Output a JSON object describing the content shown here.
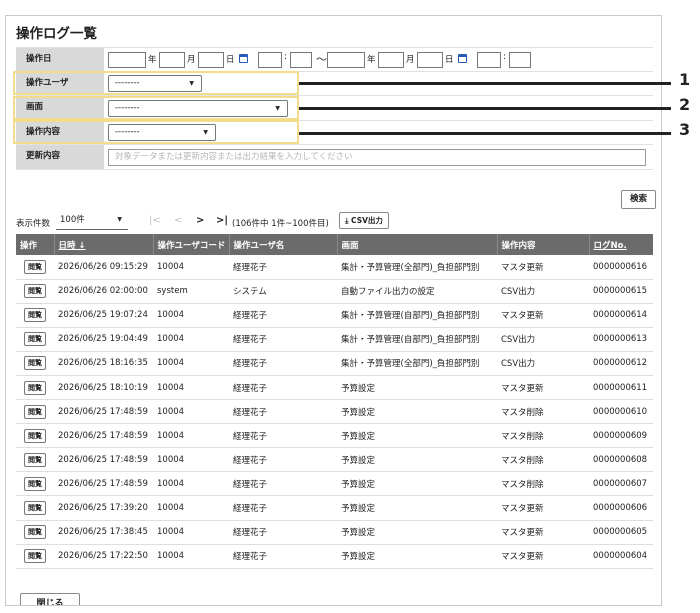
{
  "page": {
    "title": "操作ログ一覧"
  },
  "filters": {
    "date": {
      "label": "操作日",
      "year_unit": "年",
      "month_unit": "月",
      "day_unit": "日",
      "colon": ":",
      "tilde": "～"
    },
    "user": {
      "label": "操作ユーザ",
      "value": "--------"
    },
    "screen": {
      "label": "画面",
      "value": "--------"
    },
    "operation": {
      "label": "操作内容",
      "value": "--------"
    },
    "update": {
      "label": "更新内容",
      "placeholder": "対象データまたは更新内容または出力結果を入力してください"
    }
  },
  "search_button": "検索",
  "toolbar": {
    "page_size_label": "表示件数",
    "page_size_value": "100件",
    "first": "|<",
    "prev": "<",
    "next": ">",
    "last": ">|",
    "page_info": "(106件中 1件~100件目)",
    "csv_button": "CSV出力"
  },
  "table": {
    "headers": {
      "action": "操作",
      "datetime": "日時 ↓",
      "user_code": "操作ユーザコード",
      "user_name": "操作ユーザ名",
      "screen": "画面",
      "operation": "操作内容",
      "log_no": "ログNo."
    },
    "view_label": "閲覧",
    "rows": [
      {
        "datetime": "2026/06/26 09:15:29",
        "user_code": "10004",
        "user_name": "経理花子",
        "screen": "集計・予算管理(全部門)_負担部門別",
        "operation": "マスタ更新",
        "log_no": "0000000616"
      },
      {
        "datetime": "2026/06/26 02:00:00",
        "user_code": "system",
        "user_name": "システム",
        "screen": "自動ファイル出力の設定",
        "operation": "CSV出力",
        "log_no": "0000000615"
      },
      {
        "datetime": "2026/06/25 19:07:24",
        "user_code": "10004",
        "user_name": "経理花子",
        "screen": "集計・予算管理(自部門)_負担部門別",
        "operation": "マスタ更新",
        "log_no": "0000000614"
      },
      {
        "datetime": "2026/06/25 19:04:49",
        "user_code": "10004",
        "user_name": "経理花子",
        "screen": "集計・予算管理(自部門)_負担部門別",
        "operation": "CSV出力",
        "log_no": "0000000613"
      },
      {
        "datetime": "2026/06/25 18:16:35",
        "user_code": "10004",
        "user_name": "経理花子",
        "screen": "集計・予算管理(全部門)_負担部門別",
        "operation": "CSV出力",
        "log_no": "0000000612"
      },
      {
        "datetime": "2026/06/25 18:10:19",
        "user_code": "10004",
        "user_name": "経理花子",
        "screen": "予算設定",
        "operation": "マスタ更新",
        "log_no": "0000000611"
      },
      {
        "datetime": "2026/06/25 17:48:59",
        "user_code": "10004",
        "user_name": "経理花子",
        "screen": "予算設定",
        "operation": "マスタ削除",
        "log_no": "0000000610"
      },
      {
        "datetime": "2026/06/25 17:48:59",
        "user_code": "10004",
        "user_name": "経理花子",
        "screen": "予算設定",
        "operation": "マスタ削除",
        "log_no": "0000000609"
      },
      {
        "datetime": "2026/06/25 17:48:59",
        "user_code": "10004",
        "user_name": "経理花子",
        "screen": "予算設定",
        "operation": "マスタ削除",
        "log_no": "0000000608"
      },
      {
        "datetime": "2026/06/25 17:48:59",
        "user_code": "10004",
        "user_name": "経理花子",
        "screen": "予算設定",
        "operation": "マスタ削除",
        "log_no": "0000000607"
      },
      {
        "datetime": "2026/06/25 17:39:20",
        "user_code": "10004",
        "user_name": "経理花子",
        "screen": "予算設定",
        "operation": "マスタ更新",
        "log_no": "0000000606"
      },
      {
        "datetime": "2026/06/25 17:38:45",
        "user_code": "10004",
        "user_name": "経理花子",
        "screen": "予算設定",
        "operation": "マスタ更新",
        "log_no": "0000000605"
      },
      {
        "datetime": "2026/06/25 17:22:50",
        "user_code": "10004",
        "user_name": "経理花子",
        "screen": "予算設定",
        "operation": "マスタ更新",
        "log_no": "0000000604"
      }
    ]
  },
  "close_button": "閉じる",
  "callouts": [
    "1",
    "2",
    "3"
  ],
  "colors": {
    "header_bg": "#6b6b6b",
    "label_bg": "#d9d9d9",
    "highlight": "#f3dd8c",
    "calendar_icon": "#2a5ab8"
  }
}
